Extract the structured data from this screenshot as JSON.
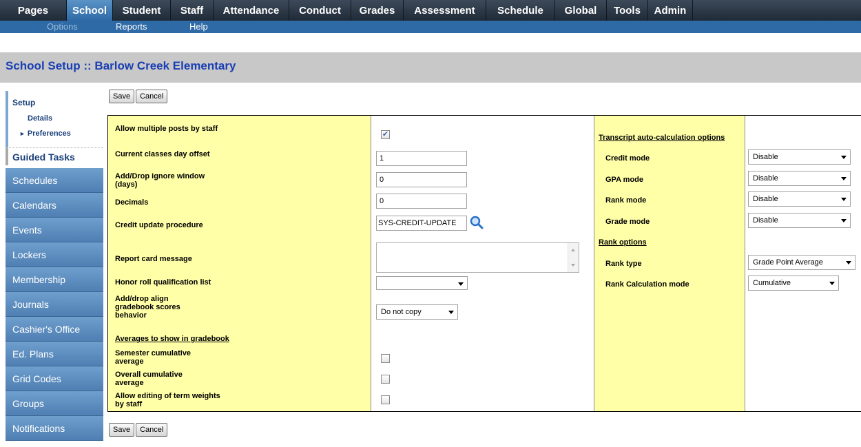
{
  "topnav": {
    "tabs": [
      {
        "label": "Pages"
      },
      {
        "label": "School",
        "active": true
      },
      {
        "label": "Student"
      },
      {
        "label": "Staff"
      },
      {
        "label": "Attendance"
      },
      {
        "label": "Conduct"
      },
      {
        "label": "Grades"
      },
      {
        "label": "Assessment"
      },
      {
        "label": "Schedule"
      },
      {
        "label": "Global"
      },
      {
        "label": "Tools"
      },
      {
        "label": "Admin"
      }
    ]
  },
  "subnav": {
    "options": "Options",
    "reports": "Reports",
    "help": "Help"
  },
  "page": {
    "title_prefix": "School Setup",
    "separator": "::",
    "title_school": "Barlow Creek Elementary"
  },
  "sidebar": {
    "setup": "Setup",
    "details": "Details",
    "preferences": "Preferences",
    "guided_tasks": "Guided Tasks",
    "items": [
      "Schedules",
      "Calendars",
      "Events",
      "Lockers",
      "Membership",
      "Journals",
      "Cashier's Office",
      "Ed. Plans",
      "Grid Codes",
      "Groups",
      "Notifications"
    ]
  },
  "buttons": {
    "save": "Save",
    "cancel": "Cancel"
  },
  "form": {
    "allow_multiple_posts": {
      "label": "Allow multiple posts by staff",
      "checked": true
    },
    "current_classes_offset": {
      "label": "Current classes day offset",
      "value": "1"
    },
    "add_drop_ignore": {
      "label": "Add/Drop ignore window (days)",
      "value": "0"
    },
    "decimals": {
      "label": "Decimals",
      "value": "0"
    },
    "credit_update": {
      "label": "Credit update procedure",
      "value": "SYS-CREDIT-UPDATE"
    },
    "report_card_message": {
      "label": "Report card message",
      "value": ""
    },
    "honor_roll": {
      "label": "Honor roll qualification list",
      "value": ""
    },
    "add_drop_align": {
      "label": "Add/drop align gradebook scores behavior",
      "value": "Do not copy"
    },
    "averages_header": "Averages to show in gradebook",
    "semester_cumulative": {
      "label": "Semester cumulative average",
      "checked": false
    },
    "overall_cumulative": {
      "label": "Overall cumulative average",
      "checked": false
    },
    "allow_editing_weights": {
      "label": "Allow editing of term weights by staff",
      "checked": false
    }
  },
  "transcript": {
    "header": "Transcript auto-calculation options",
    "credit_mode": {
      "label": "Credit mode",
      "value": "Disable"
    },
    "gpa_mode": {
      "label": "GPA mode",
      "value": "Disable"
    },
    "rank_mode": {
      "label": "Rank mode",
      "value": "Disable"
    },
    "grade_mode": {
      "label": "Grade mode",
      "value": "Disable"
    },
    "rank_header": "Rank options",
    "rank_type": {
      "label": "Rank type",
      "value": "Grade Point Average"
    },
    "rank_calc_mode": {
      "label": "Rank Calculation mode",
      "value": "Cumulative"
    }
  },
  "colors": {
    "nav_dark": "#1f2a36",
    "nav_active": "#2e6aa6",
    "title_blue": "#1a3fb3",
    "form_yellow": "#ffffa8",
    "sidebar_blue": "#5f8fc2"
  }
}
